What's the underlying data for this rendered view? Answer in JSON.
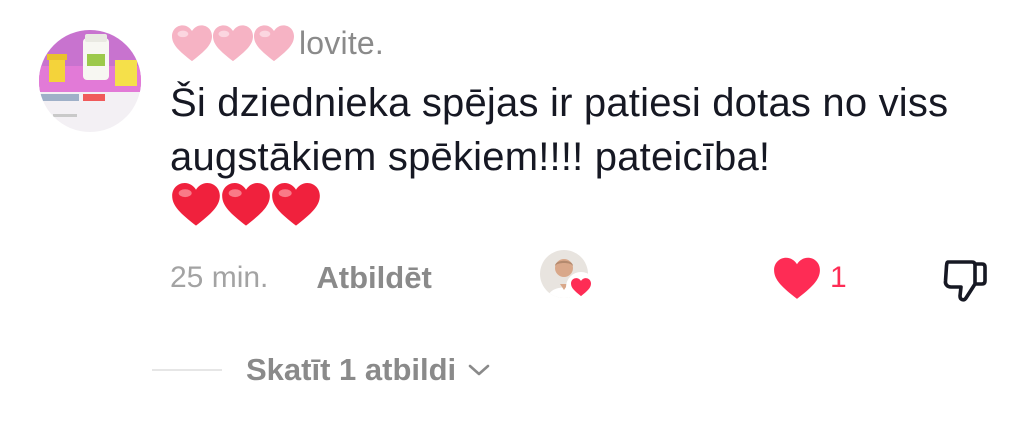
{
  "comment": {
    "avatar_icon": "avatar-supplement-product",
    "username_emoji_icon": "pink-heart-icon",
    "username": "lovite.",
    "text": "Ši dziednieka spējas ir patiesi dotas no viss augstākiem spēkiem!!!! pateicība!",
    "emoji_icon": "red-heart-icon",
    "timestamp": "25 min.",
    "reply_label": "Atbildēt",
    "creator_like_icon": "creator-liked-avatar",
    "like_icon": "heart-icon",
    "like_count": "1",
    "dislike_icon": "thumbs-down-icon"
  },
  "replies": {
    "label": "Skatīt 1 atbildi",
    "chevron_icon": "chevron-down-icon"
  },
  "colors": {
    "accent": "#fe2c55",
    "muted_text": "#8a8a8a",
    "timestamp": "#a3a3a3",
    "body_text": "#161823",
    "pink_heart": "#f6b3c4"
  }
}
